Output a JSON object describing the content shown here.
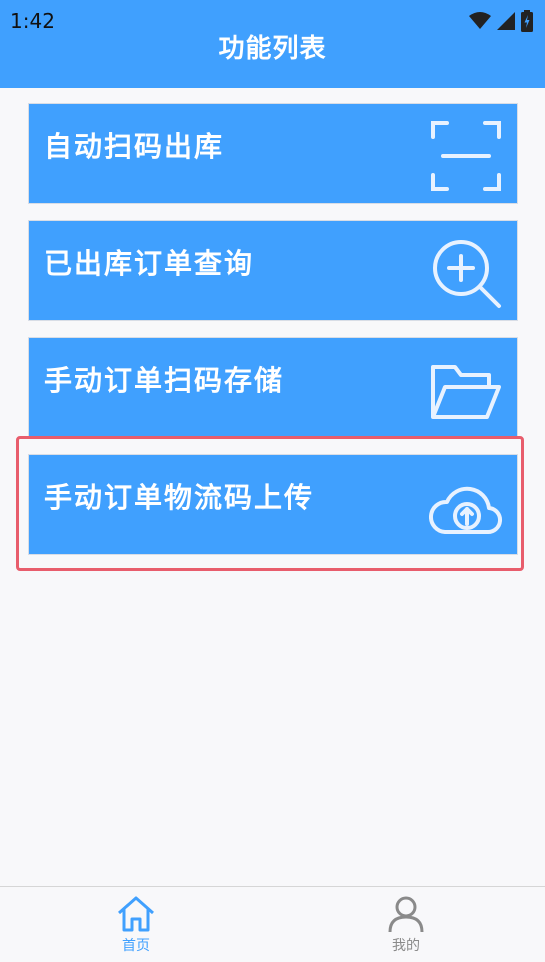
{
  "status_bar": {
    "time": "1:42",
    "icons": [
      "wifi-icon",
      "signal-icon",
      "battery-icon"
    ]
  },
  "header": {
    "title": "功能列表"
  },
  "menu": {
    "items": [
      {
        "label": "自动扫码出库",
        "icon": "scan-frame-icon"
      },
      {
        "label": "已出库订单查询",
        "icon": "zoom-in-search-icon"
      },
      {
        "label": "手动订单扫码存储",
        "icon": "folder-open-icon"
      },
      {
        "label": "手动订单物流码上传",
        "icon": "cloud-upload-icon",
        "highlighted": true
      }
    ]
  },
  "tabbar": {
    "tabs": [
      {
        "label": "首页",
        "icon": "home-icon",
        "active": true
      },
      {
        "label": "我的",
        "icon": "user-icon",
        "active": false
      }
    ]
  },
  "colors": {
    "primary": "#40a0fe",
    "highlight": "#e85d6c",
    "inactive": "#8a8a8a",
    "background": "#f8f8fa"
  }
}
